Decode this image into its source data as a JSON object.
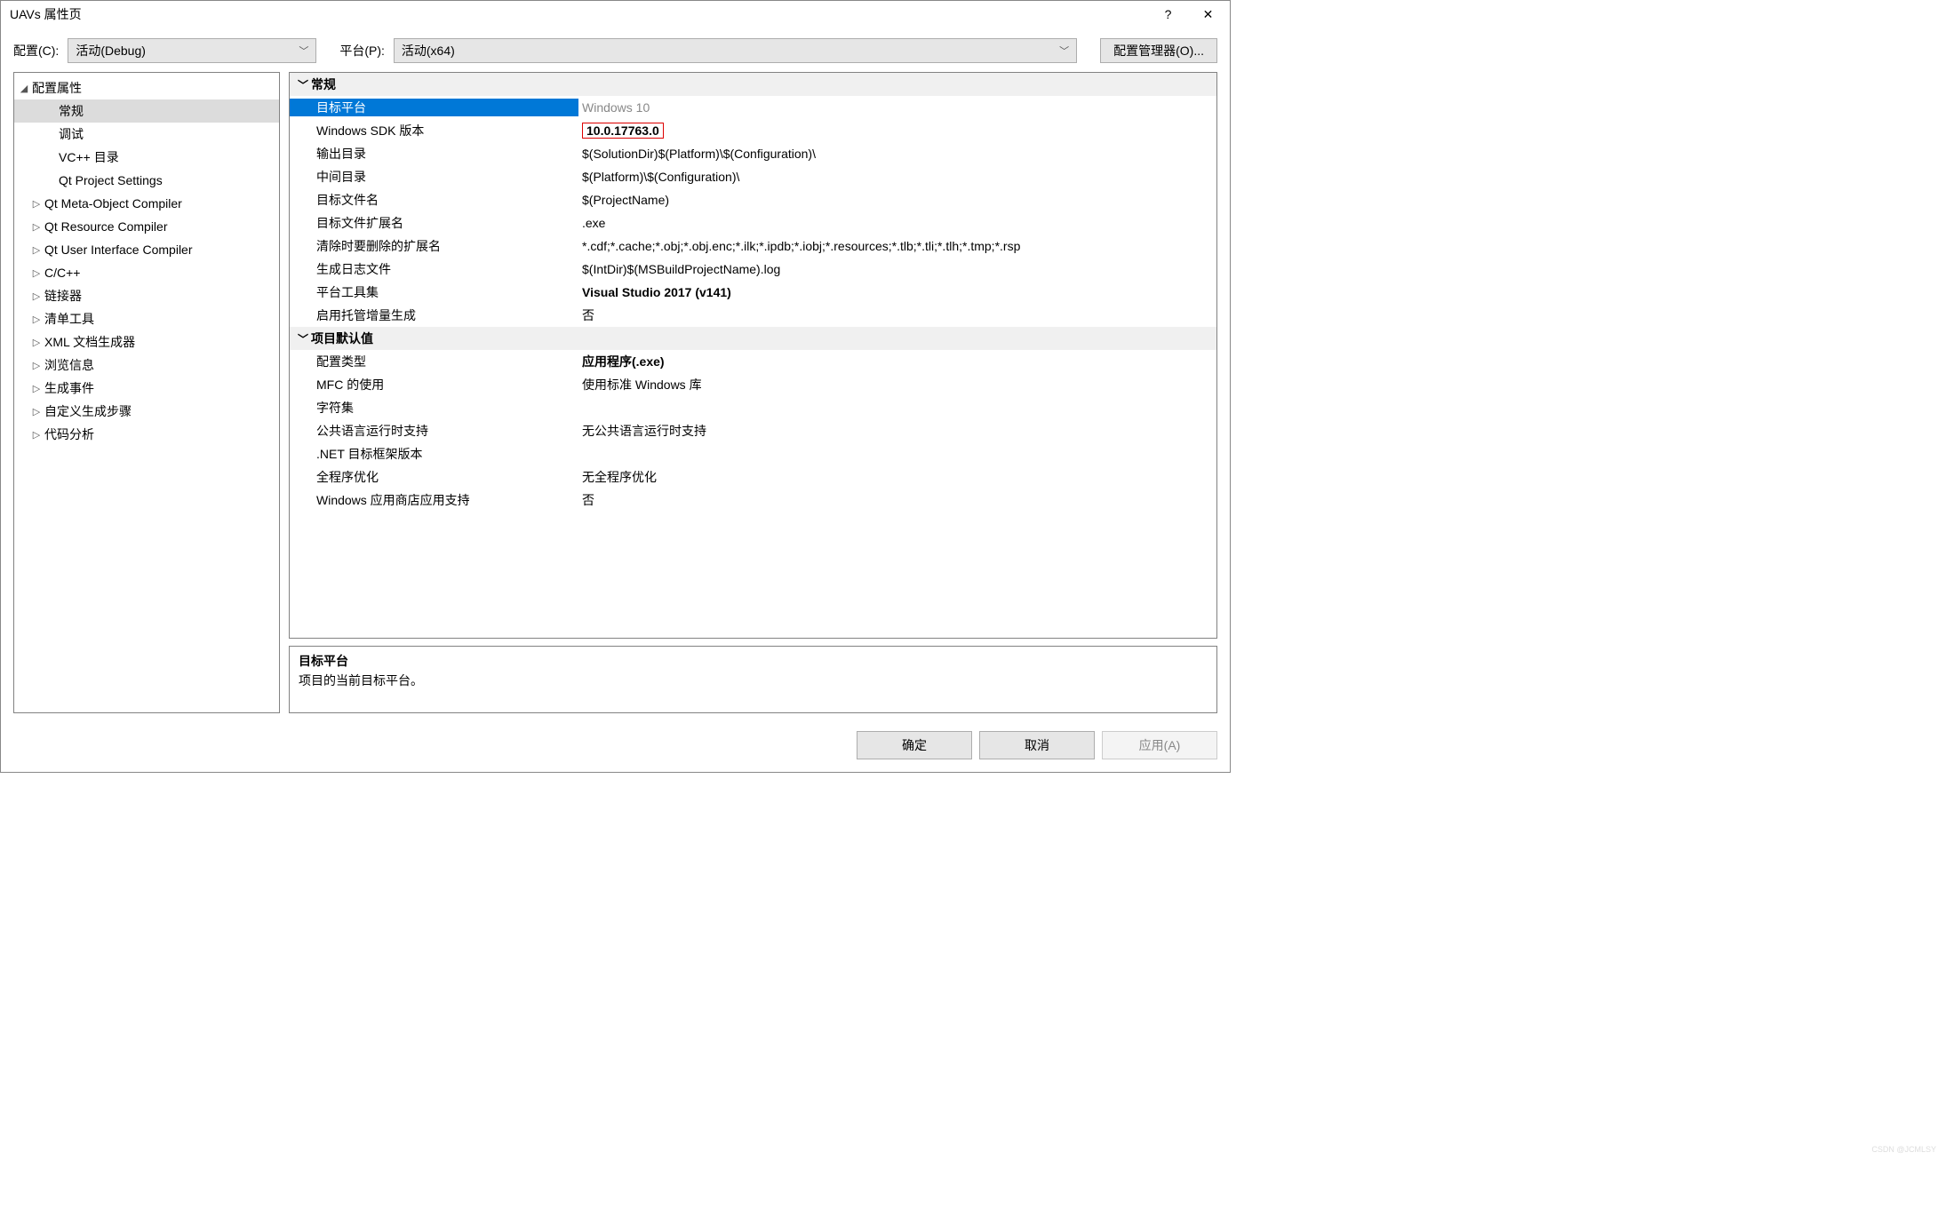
{
  "window": {
    "title": "UAVs 属性页",
    "help_icon": "?",
    "close_icon": "✕"
  },
  "toolbar": {
    "config_label": "配置(C):",
    "config_value": "活动(Debug)",
    "platform_label": "平台(P):",
    "platform_value": "活动(x64)",
    "config_manager_btn": "配置管理器(O)..."
  },
  "tree": {
    "root": "配置属性",
    "items": [
      {
        "label": "常规",
        "selected": true
      },
      {
        "label": "调试"
      },
      {
        "label": "VC++ 目录"
      },
      {
        "label": "Qt Project Settings"
      },
      {
        "label": "Qt Meta-Object Compiler",
        "tw": "▷"
      },
      {
        "label": "Qt Resource Compiler",
        "tw": "▷"
      },
      {
        "label": "Qt User Interface Compiler",
        "tw": "▷"
      },
      {
        "label": "C/C++",
        "tw": "▷"
      },
      {
        "label": "链接器",
        "tw": "▷"
      },
      {
        "label": "清单工具",
        "tw": "▷"
      },
      {
        "label": "XML 文档生成器",
        "tw": "▷"
      },
      {
        "label": "浏览信息",
        "tw": "▷"
      },
      {
        "label": "生成事件",
        "tw": "▷"
      },
      {
        "label": "自定义生成步骤",
        "tw": "▷"
      },
      {
        "label": "代码分析",
        "tw": "▷"
      }
    ]
  },
  "grid": {
    "sections": [
      {
        "title": "常规",
        "rows": [
          {
            "name": "目标平台",
            "value": "Windows 10",
            "selected": true
          },
          {
            "name": "Windows SDK 版本",
            "value": "10.0.17763.0",
            "boxed": true
          },
          {
            "name": "输出目录",
            "value": "$(SolutionDir)$(Platform)\\$(Configuration)\\"
          },
          {
            "name": "中间目录",
            "value": "$(Platform)\\$(Configuration)\\"
          },
          {
            "name": "目标文件名",
            "value": "$(ProjectName)"
          },
          {
            "name": "目标文件扩展名",
            "value": ".exe"
          },
          {
            "name": "清除时要删除的扩展名",
            "value": "*.cdf;*.cache;*.obj;*.obj.enc;*.ilk;*.ipdb;*.iobj;*.resources;*.tlb;*.tli;*.tlh;*.tmp;*.rsp"
          },
          {
            "name": "生成日志文件",
            "value": "$(IntDir)$(MSBuildProjectName).log"
          },
          {
            "name": "平台工具集",
            "value": "Visual Studio 2017 (v141)",
            "bold": true
          },
          {
            "name": "启用托管增量生成",
            "value": "否"
          }
        ]
      },
      {
        "title": "项目默认值",
        "rows": [
          {
            "name": "配置类型",
            "value": "应用程序(.exe)",
            "bold": true
          },
          {
            "name": "MFC 的使用",
            "value": "使用标准 Windows 库"
          },
          {
            "name": "字符集",
            "value": ""
          },
          {
            "name": "公共语言运行时支持",
            "value": "无公共语言运行时支持"
          },
          {
            "name": ".NET 目标框架版本",
            "value": ""
          },
          {
            "name": "全程序优化",
            "value": "无全程序优化"
          },
          {
            "name": "Windows 应用商店应用支持",
            "value": "否"
          }
        ]
      }
    ]
  },
  "description": {
    "heading": "目标平台",
    "text": "项目的当前目标平台。"
  },
  "footer": {
    "ok": "确定",
    "cancel": "取消",
    "apply": "应用(A)"
  },
  "watermark": "CSDN @JCMLSY"
}
